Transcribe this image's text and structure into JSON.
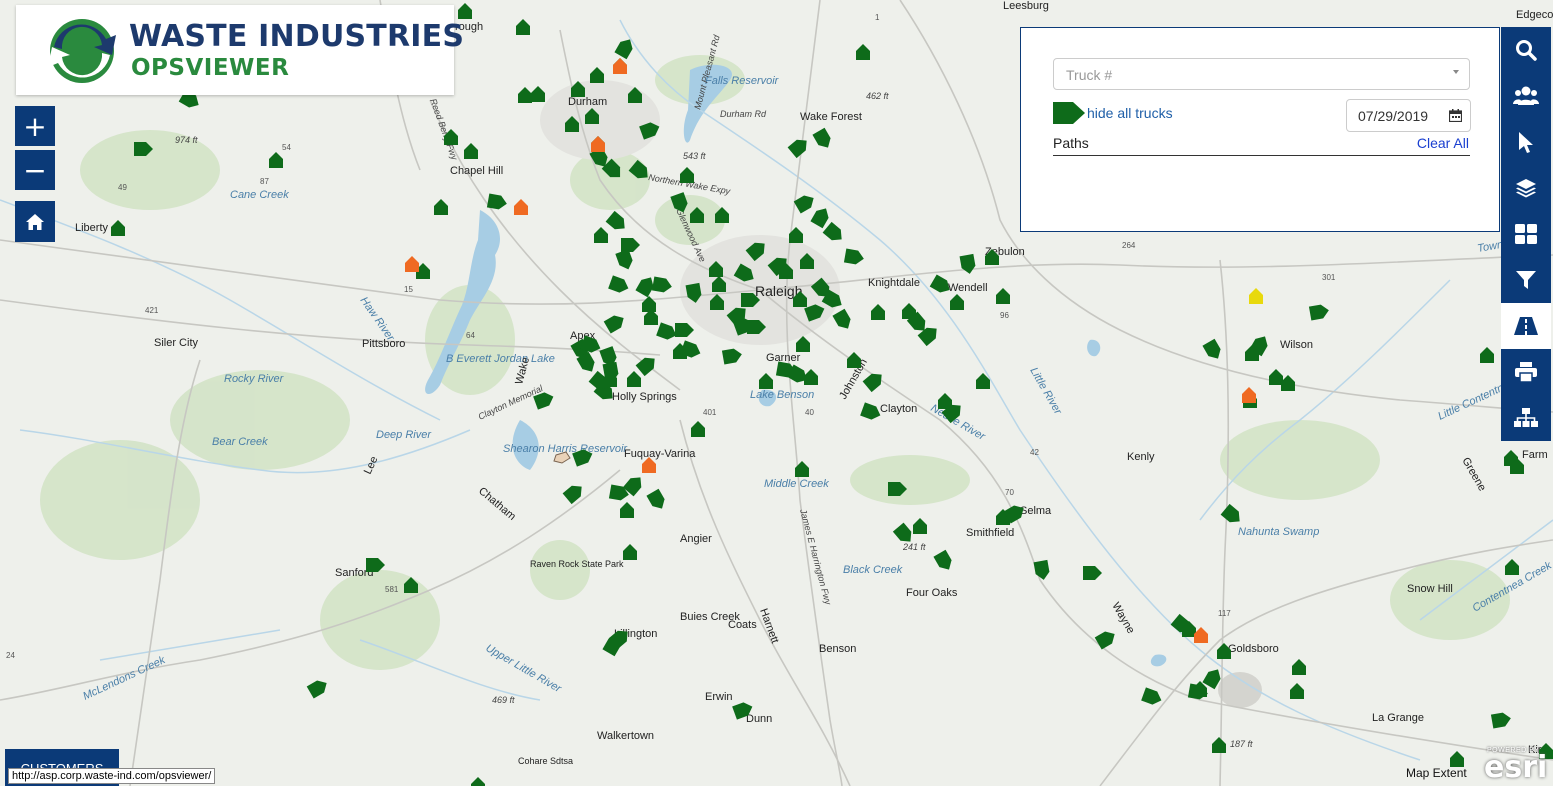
{
  "app": {
    "logo_line1": "WASTE INDUSTRIES",
    "logo_line2": "OPSVIEWER"
  },
  "zoom": {
    "in": "+",
    "out": "−"
  },
  "panel": {
    "truck_placeholder": "Truck #",
    "hide_trucks_label": "hide all trucks",
    "date_value": "07/29/2019",
    "paths_label": "Paths",
    "clear_all_label": "Clear All"
  },
  "toolbar": [
    "search-icon",
    "users-icon",
    "pointer-icon",
    "layers-icon",
    "grid-icon",
    "filter-icon",
    "road-icon",
    "print-icon",
    "org-chart-icon"
  ],
  "customers_label": "CUSTOMERS",
  "status_url": "http://asp.corp.waste-ind.com/opsviewer/",
  "attribution": {
    "map_extent": "Map Extent",
    "powered": "POWERED BY",
    "esri": "esri"
  },
  "colors": {
    "nav": "#0b3a78",
    "truck_green": "#0e6b1a",
    "truck_orange": "#ef6a22",
    "truck_yellow": "#e8d90c",
    "water": "#a7cde4",
    "land": "#eef0eb",
    "park": "#cfe0c4"
  },
  "places": [
    {
      "name": "Leesburg"
    },
    {
      "name": "Edgecomb"
    },
    {
      "name": "rough"
    },
    {
      "name": "Durham"
    },
    {
      "name": "Falls Reservoir"
    },
    {
      "name": "Wake Forest"
    },
    {
      "name": "Chapel Hill"
    },
    {
      "name": "Liberty"
    },
    {
      "name": "Cane Creek"
    },
    {
      "name": "Raleigh"
    },
    {
      "name": "Knightdale"
    },
    {
      "name": "Wendell"
    },
    {
      "name": "Zebulon"
    },
    {
      "name": "Wilson"
    },
    {
      "name": "Siler City"
    },
    {
      "name": "Pittsboro"
    },
    {
      "name": "B Everett Jordan Lake"
    },
    {
      "name": "Apex"
    },
    {
      "name": "Garner"
    },
    {
      "name": "Holly Springs"
    },
    {
      "name": "Lake Benson"
    },
    {
      "name": "Clayton"
    },
    {
      "name": "Rocky River"
    },
    {
      "name": "Bear Creek"
    },
    {
      "name": "Deep River"
    },
    {
      "name": "Shearon Harris Reservoir"
    },
    {
      "name": "Fuquay-Varina"
    },
    {
      "name": "Kenly"
    },
    {
      "name": "Middle Creek"
    },
    {
      "name": "Selma"
    },
    {
      "name": "Smithfield"
    },
    {
      "name": "Angier"
    },
    {
      "name": "Raven Rock State Park"
    },
    {
      "name": "Sanford"
    },
    {
      "name": "Four Oaks"
    },
    {
      "name": "Snow Hill"
    },
    {
      "name": "Buies Creek"
    },
    {
      "name": "Coats"
    },
    {
      "name": "Lillington"
    },
    {
      "name": "Benson"
    },
    {
      "name": "Goldsboro"
    },
    {
      "name": "Erwin"
    },
    {
      "name": "Dunn"
    },
    {
      "name": "La Grange"
    },
    {
      "name": "Walkertown"
    },
    {
      "name": "Cohare Sdtsa"
    },
    {
      "name": "Farm"
    },
    {
      "name": "Kirst"
    },
    {
      "name": "Haw River"
    },
    {
      "name": "Neuse River"
    },
    {
      "name": "Little River"
    },
    {
      "name": "Nahunta Swamp"
    },
    {
      "name": "Black Creek"
    },
    {
      "name": "Upper Little River"
    },
    {
      "name": "McLendons Creek"
    },
    {
      "name": "James E Harrington Fwy"
    },
    {
      "name": "Wake"
    },
    {
      "name": "Johnston"
    },
    {
      "name": "Lee"
    },
    {
      "name": "Chatham"
    },
    {
      "name": "Harnett"
    },
    {
      "name": "Wayne"
    },
    {
      "name": "Greene"
    },
    {
      "name": "Town Creek"
    },
    {
      "name": "Contentnea Creek"
    },
    {
      "name": "Little Contentnea Creek"
    },
    {
      "name": "Northern Wake Expy"
    },
    {
      "name": "Durham Rd"
    },
    {
      "name": "Glenwood Ave"
    },
    {
      "name": "Mount Pleasant Rd"
    },
    {
      "name": "Clayton Memorial"
    },
    {
      "name": "Reed Berry Fwy"
    },
    {
      "name": "974 ft"
    },
    {
      "name": "462 ft"
    },
    {
      "name": "543 ft"
    },
    {
      "name": "241 ft"
    },
    {
      "name": "469 ft"
    },
    {
      "name": "187 ft"
    }
  ],
  "highway_shields": [
    "54",
    "49",
    "87",
    "15",
    "64",
    "40",
    "401",
    "96",
    "42",
    "117",
    "24",
    "421",
    "301",
    "581",
    "264",
    "70",
    "1"
  ]
}
